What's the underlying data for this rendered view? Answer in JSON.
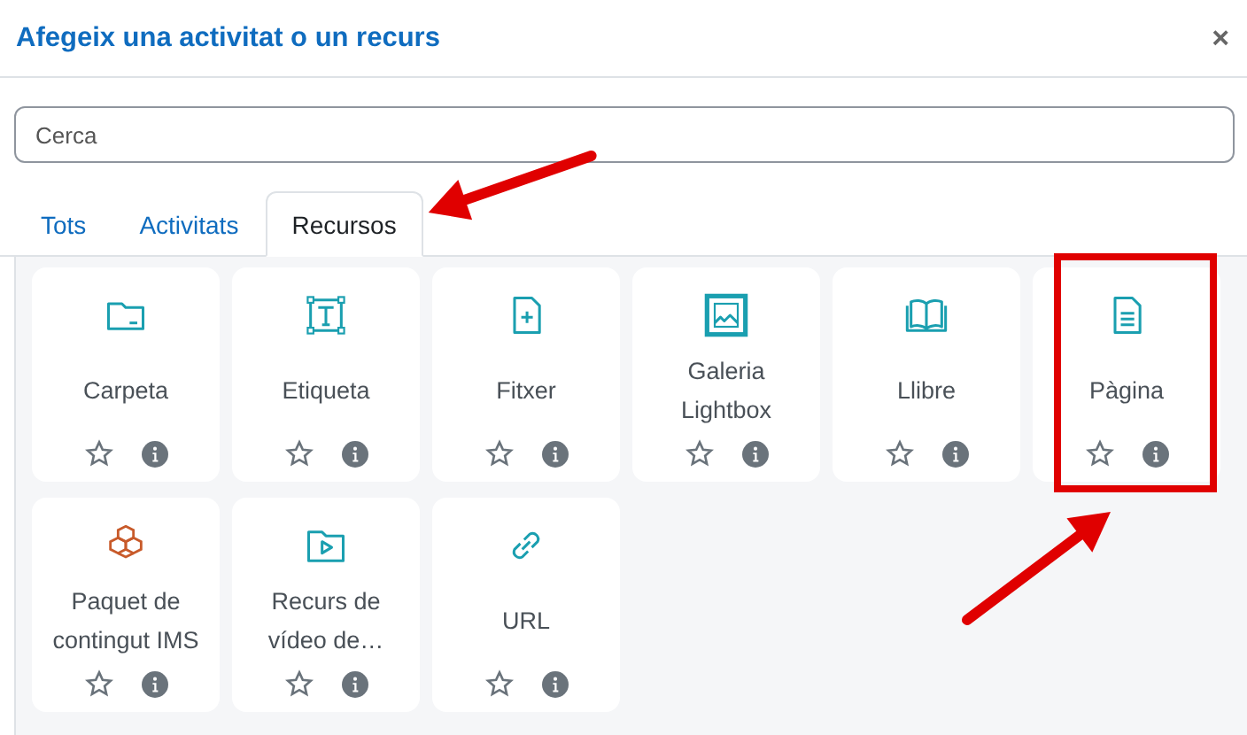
{
  "dialog": {
    "title": "Afegeix una activitat o un recurs",
    "close": "×"
  },
  "search": {
    "placeholder": "Cerca"
  },
  "tabs": [
    {
      "label": "Tots",
      "selected": false,
      "pointed_at": false
    },
    {
      "label": "Activitats",
      "selected": false,
      "pointed_at": false
    },
    {
      "label": "Recursos",
      "selected": true,
      "pointed_at": true
    }
  ],
  "items": [
    {
      "kind": "folder",
      "name": "Carpeta",
      "highlighted": false
    },
    {
      "kind": "label",
      "name": "Etiqueta",
      "highlighted": false
    },
    {
      "kind": "file",
      "name": "Fitxer",
      "highlighted": false
    },
    {
      "kind": "gallery",
      "name": "Galeria Lightbox",
      "highlighted": false
    },
    {
      "kind": "book",
      "name": "Llibre",
      "highlighted": false
    },
    {
      "kind": "page",
      "name": "Pàgina",
      "highlighted": true
    },
    {
      "kind": "package",
      "name": "Paquet de contingut IMS",
      "highlighted": false
    },
    {
      "kind": "video",
      "name": "Recurs de vídeo de…",
      "highlighted": false
    },
    {
      "kind": "url",
      "name": "URL",
      "highlighted": false
    }
  ]
}
